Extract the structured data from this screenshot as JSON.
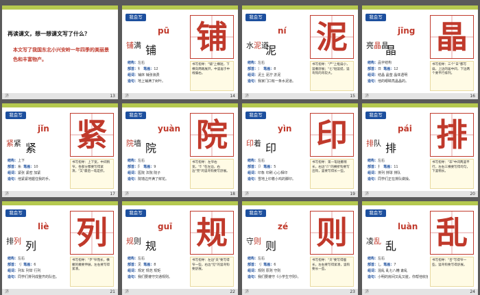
{
  "slides": [
    {
      "type": "intro",
      "page": "13",
      "question": "再读课文，想一想课文写了什么？",
      "answer": "本文写了我国东北小兴安岭一年四季的美丽景色和丰富物产。"
    },
    {
      "type": "char",
      "page": "14",
      "badge": "我会写",
      "word_before": "铺满",
      "hl_index": 0,
      "char": "铺",
      "pinyin": "pū",
      "structure": "左右",
      "radical": "钅",
      "strokes": "12",
      "group": "铺床 铺张浪费",
      "sentence": "地上铺满了树叶。",
      "tip": "书写指导：\"铺\"上横短，下横向两端展开，中竖居于中线偏右。"
    },
    {
      "type": "char",
      "page": "15",
      "badge": "我会写",
      "word_before": "水泥道",
      "hl_index": 1,
      "char": "泥",
      "pinyin": "ní",
      "structure": "左右",
      "radical": "氵",
      "strokes": "8",
      "group": "泥土 泥泞 淤泥",
      "sentence": "我家门口有一条水泥道。",
      "tip": "书写指导：\"尸\"上框扁小，竖撇舒展；\"匕\"短竖提，竖弯钩的弯较大。"
    },
    {
      "type": "char",
      "page": "16",
      "badge": "我会写",
      "word_before": "亮晶晶",
      "hl_index": 1,
      "char": "晶",
      "pinyin": "jīng",
      "structure": "品字结构",
      "radical": "日",
      "strokes": "12",
      "group": "结晶 晶莹 晶体透明",
      "sentence": "他的眼睛亮晶晶的。",
      "tip": "书写指导：三个\"日\"都写扁，上边的居中间，下边两个要平行排列。"
    },
    {
      "type": "char",
      "page": "17",
      "badge": "我会写",
      "word_before": "紧紧",
      "hl_index": 0,
      "char": "紧",
      "pinyin": "jǐn",
      "structure": "上下",
      "radical": "糸",
      "strokes": "10",
      "group": "紧张 紧密 加紧",
      "sentence": "他紧紧地握住我的手。",
      "tip": "书写指导：上下宽，中间稍窄，各部分都要写得紧凑，\"又\"最后一笔是捺。"
    },
    {
      "type": "char",
      "page": "18",
      "badge": "我会写",
      "word_before": "院墙",
      "hl_index": 0,
      "char": "院",
      "pinyin": "yuàn",
      "structure": "左右",
      "radical": "阝",
      "strokes": "9",
      "group": "医院 法院 院子",
      "sentence": "院墙边开满了鲜花。",
      "tip": "书写指导：左窄右宽，\"阝\"在左边，右边\"完\"的竖弯钩要写舒展。"
    },
    {
      "type": "char",
      "page": "19",
      "badge": "我会写",
      "word_before": "印着",
      "hl_index": 0,
      "char": "印",
      "pinyin": "yìn",
      "structure": "左右",
      "radical": "卩",
      "strokes": "5",
      "group": "印象 印刷 心心相印",
      "sentence": "雪地上印着小鸡的脚印。",
      "tip": "书写指导：第一笔短撇稍长，右边\"卩\"的横折钩要写出钩，竖要写得长一些。"
    },
    {
      "type": "char",
      "page": "20",
      "badge": "我会写",
      "word_before": "排队",
      "hl_index": 0,
      "char": "排",
      "pinyin": "pái",
      "structure": "左右",
      "radical": "扌",
      "strokes": "11",
      "group": "排列 排球 排队",
      "sentence": "同学们正在排队做操。",
      "tip": "书写指导：\"非\"中间两竖平行，左右三横要写得均匀，下竖稍长。"
    },
    {
      "type": "char",
      "page": "21",
      "badge": "我会写",
      "word_before": "排列",
      "hl_index": 1,
      "char": "列",
      "pinyin": "liè",
      "structure": "左右",
      "radical": "刂",
      "strokes": "6",
      "group": "列车 列举 行列",
      "sentence": "同学们排列成整齐的队伍。",
      "tip": "书写指导：\"歹\"窄而长，横撇的撇要伸展，左右要写得紧凑。"
    },
    {
      "type": "char",
      "page": "22",
      "badge": "我会写",
      "word_before": "规则",
      "hl_index": 0,
      "char": "规",
      "pinyin": "guī",
      "structure": "左右",
      "radical": "见",
      "strokes": "8",
      "group": "规定 规范 规矩",
      "sentence": "我们要遵守交通规则。",
      "tip": "书写指导：左边\"夫\"要写得窄一些，右边\"见\"的竖弯钩要舒展。"
    },
    {
      "type": "char",
      "page": "23",
      "badge": "我会写",
      "word_before": "守则",
      "hl_index": 1,
      "char": "则",
      "pinyin": "zé",
      "structure": "左右",
      "radical": "刂",
      "strokes": "6",
      "group": "规则 原则 守则",
      "sentence": "我们要遵守《小学生守则》。",
      "tip": "书写指导：\"贝\"要写得瘦长，左右要写得紧凑，竖钩要长一些。"
    },
    {
      "type": "char",
      "page": "24",
      "badge": "我会写",
      "word_before": "凌乱",
      "hl_index": 1,
      "char": "乱",
      "pinyin": "luàn",
      "structure": "左右",
      "radical": "乚",
      "strokes": "7",
      "group": "混乱 乱七八糟 紊乱",
      "sentence": "小明的房间又乱又脏，你帮他收拾一下吧。",
      "tip": "书写指导：\"舌\"写得窄一些，竖弯钩要写得舒展。"
    }
  ],
  "labels": {
    "structure": "结构：",
    "radical": "部首：",
    "strokes": "笔画：",
    "group": "组词：",
    "sentence": "造句：",
    "footer_left": "济"
  },
  "colors": {
    "top_bar": "#b5c94f",
    "accent_red": "#c0392b",
    "badge_blue": "#1c4f9e",
    "background": "#5a5a5a"
  }
}
